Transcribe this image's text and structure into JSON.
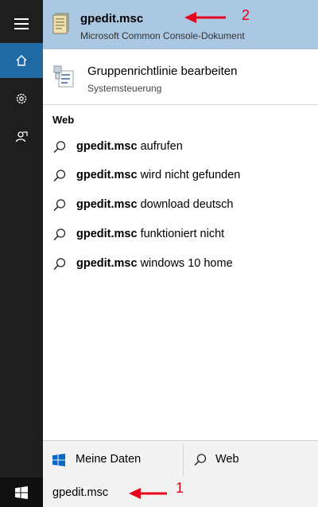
{
  "top_result": {
    "title": "gpedit.msc",
    "subtitle": "Microsoft Common Console-Dokument"
  },
  "second_result": {
    "title": "Gruppenrichtlinie bearbeiten",
    "subtitle": "Systemsteuerung"
  },
  "web_section": {
    "heading": "Web",
    "suggestions": [
      {
        "bold": "gpedit.msc",
        "rest": " aufrufen"
      },
      {
        "bold": "gpedit.msc",
        "rest": " wird nicht gefunden"
      },
      {
        "bold": "gpedit.msc",
        "rest": " download deutsch"
      },
      {
        "bold": "gpedit.msc",
        "rest": " funktioniert nicht"
      },
      {
        "bold": "gpedit.msc",
        "rest": " windows 10 home"
      }
    ]
  },
  "bottom_bar": {
    "my_data_label": "Meine Daten",
    "web_label": "Web"
  },
  "search": {
    "query": "gpedit.msc"
  },
  "annotations": {
    "marker_1": "1",
    "marker_2": "2"
  },
  "colors": {
    "highlight": "#aac8e2",
    "active_rail": "#1f6aa5",
    "annotation_red": "#e8001c"
  }
}
